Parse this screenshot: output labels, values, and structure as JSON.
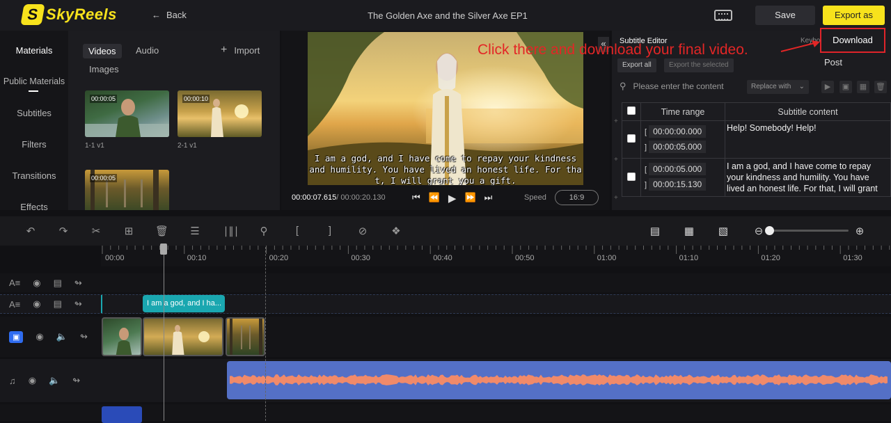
{
  "header": {
    "logo_text": "SkyReels",
    "back_label": "Back",
    "project_title": "The Golden Axe and the Silver Axe EP1",
    "save_label": "Save",
    "export_label": "Export as"
  },
  "export_menu": {
    "items": [
      "Download",
      "Post"
    ],
    "annotation": "Click there and download your final video."
  },
  "sidebar": {
    "items": [
      "Materials",
      "Public Materials",
      "Subtitles",
      "Filters",
      "Transitions",
      "Effects"
    ]
  },
  "materials": {
    "tabs": [
      "Videos",
      "Audio",
      "Images"
    ],
    "import_label": "Import",
    "clips": [
      {
        "duration": "00:00:05",
        "label": "1-1 v1"
      },
      {
        "duration": "00:00:10",
        "label": "2-1 v1"
      },
      {
        "duration": "00:00:05",
        "label": ""
      }
    ]
  },
  "preview": {
    "subtitle_text": "I am a god, and I have come to repay your kindness and humility. You have lived an honest life. For tha t, I will grant you a gift.",
    "current_time": "00:00:07.615",
    "total_time": "/ 00:00:20.130",
    "speed_label": "Speed",
    "ratio": "16:9"
  },
  "subtitle_editor": {
    "title": "Subtitle Editor",
    "keyboard_hint": "Keybo",
    "export_all": "Export all",
    "export_selected": "Export the selected",
    "search_placeholder": "Please enter the content",
    "replace_label": "Replace with",
    "columns": [
      "Time range",
      "Subtitle content"
    ],
    "rows": [
      {
        "start": "00:00:00.000",
        "end": "00:00:05.000",
        "text": "Help! Somebody! Help!"
      },
      {
        "start": "00:00:05.000",
        "end": "00:00:15.130",
        "text": "I am a god, and I have come to repay your kindness and humility. You have lived an honest life. For that, I will grant"
      }
    ]
  },
  "timeline": {
    "ruler": [
      "00:00",
      "00:10",
      "00:20",
      "00:30",
      "00:40",
      "00:50",
      "01:00",
      "01:10",
      "01:20",
      "01:30"
    ],
    "subtitle_clip": "I am a god, and I ha..."
  },
  "colors": {
    "accent_yellow": "#f7e21c",
    "annotation_red": "#e32626",
    "subtitle_clip": "#1aa7b0",
    "audio_clip": "#5470c6",
    "waveform": "#f08a6a"
  }
}
